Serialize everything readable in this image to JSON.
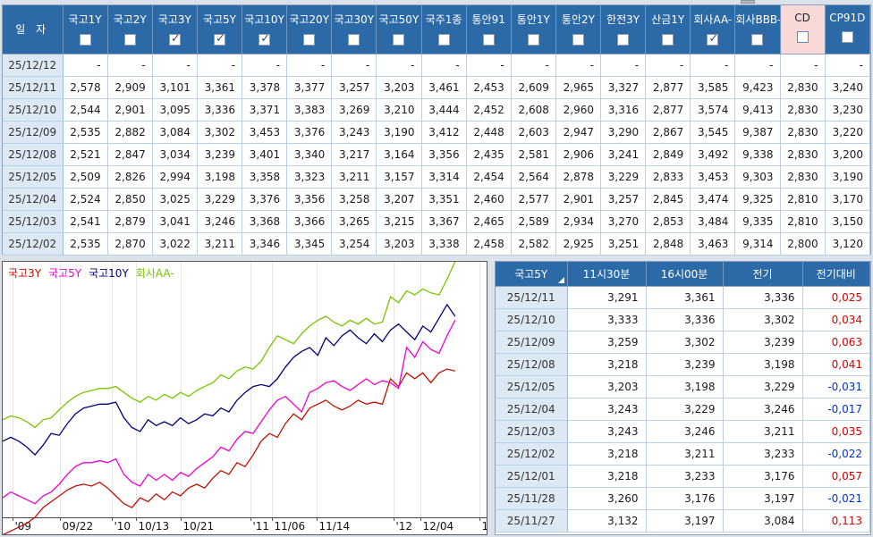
{
  "colors": {
    "header_blue": "#2b6aa6",
    "cd_pink": "#f9d8d8",
    "change_up": "#d40000",
    "change_down": "#0033cc"
  },
  "main_table": {
    "date_header": "일  자",
    "columns": [
      {
        "label": "국고1Y",
        "checked": false
      },
      {
        "label": "국고2Y",
        "checked": false
      },
      {
        "label": "국고3Y",
        "checked": true
      },
      {
        "label": "국고5Y",
        "checked": true
      },
      {
        "label": "국고10Y",
        "checked": true
      },
      {
        "label": "국고20Y",
        "checked": false
      },
      {
        "label": "국고30Y",
        "checked": false
      },
      {
        "label": "국고50Y",
        "checked": false
      },
      {
        "label": "국주1종",
        "checked": false
      },
      {
        "label": "통안91",
        "checked": false
      },
      {
        "label": "통안1Y",
        "checked": false
      },
      {
        "label": "통안2Y",
        "checked": false
      },
      {
        "label": "한전3Y",
        "checked": false
      },
      {
        "label": "산금1Y",
        "checked": false
      },
      {
        "label": "회사AA-",
        "checked": true
      },
      {
        "label": "회사BBB-",
        "checked": false
      },
      {
        "label": "CD",
        "checked": false,
        "highlight": true
      },
      {
        "label": "CP91D",
        "checked": false
      }
    ],
    "rows": [
      {
        "date": "25/12/12",
        "values": [
          "-",
          "-",
          "-",
          "-",
          "-",
          "-",
          "-",
          "-",
          "-",
          "-",
          "-",
          "-",
          "-",
          "-",
          "-",
          "-",
          "-",
          "-"
        ]
      },
      {
        "date": "25/12/11",
        "values": [
          "2,578",
          "2,909",
          "3,101",
          "3,361",
          "3,378",
          "3,377",
          "3,257",
          "3,203",
          "3,461",
          "2,453",
          "2,609",
          "2,965",
          "3,327",
          "2,877",
          "3,585",
          "9,423",
          "2,830",
          "3,240"
        ]
      },
      {
        "date": "25/12/10",
        "values": [
          "2,544",
          "2,901",
          "3,095",
          "3,336",
          "3,371",
          "3,383",
          "3,269",
          "3,210",
          "3,444",
          "2,452",
          "2,608",
          "2,960",
          "3,316",
          "2,877",
          "3,574",
          "9,413",
          "2,830",
          "3,230"
        ]
      },
      {
        "date": "25/12/09",
        "values": [
          "2,535",
          "2,882",
          "3,084",
          "3,302",
          "3,453",
          "3,376",
          "3,243",
          "3,190",
          "3,412",
          "2,448",
          "2,603",
          "2,947",
          "3,290",
          "2,867",
          "3,545",
          "9,387",
          "2,830",
          "3,220"
        ]
      },
      {
        "date": "25/12/08",
        "values": [
          "2,521",
          "2,847",
          "3,034",
          "3,239",
          "3,401",
          "3,340",
          "3,217",
          "3,164",
          "3,356",
          "2,435",
          "2,581",
          "2,906",
          "3,241",
          "2,849",
          "3,492",
          "9,338",
          "2,830",
          "3,200"
        ]
      },
      {
        "date": "25/12/05",
        "values": [
          "2,509",
          "2,826",
          "2,994",
          "3,198",
          "3,358",
          "3,323",
          "3,211",
          "3,157",
          "3,314",
          "2,454",
          "2,564",
          "2,878",
          "3,229",
          "2,833",
          "3,453",
          "9,303",
          "2,830",
          "3,190"
        ]
      },
      {
        "date": "25/12/04",
        "values": [
          "2,524",
          "2,850",
          "3,025",
          "3,229",
          "3,376",
          "3,356",
          "3,258",
          "3,207",
          "3,351",
          "2,460",
          "2,577",
          "2,901",
          "3,257",
          "2,845",
          "3,474",
          "9,325",
          "2,810",
          "3,170"
        ]
      },
      {
        "date": "25/12/03",
        "values": [
          "2,541",
          "2,879",
          "3,041",
          "3,246",
          "3,368",
          "3,366",
          "3,265",
          "3,215",
          "3,367",
          "2,465",
          "2,589",
          "2,934",
          "3,270",
          "2,853",
          "3,484",
          "9,335",
          "2,810",
          "3,150"
        ]
      },
      {
        "date": "25/12/02",
        "values": [
          "2,535",
          "2,870",
          "3,022",
          "3,211",
          "3,346",
          "3,345",
          "3,254",
          "3,203",
          "3,338",
          "2,458",
          "2,582",
          "2,925",
          "3,251",
          "2,848",
          "3,463",
          "9,314",
          "2,800",
          "3,120"
        ]
      }
    ]
  },
  "chart_data": {
    "type": "line",
    "title": "",
    "xlabel": "",
    "ylabel": "",
    "ylim": [
      2.35,
      3.65
    ],
    "grid": "vertical",
    "legend_position": "top-left",
    "x_tick_labels": [
      "'09",
      "09/22",
      "'10",
      "10/13",
      "10/21",
      "'11",
      "11/06",
      "11/14",
      "'12",
      "12/04",
      "1"
    ],
    "x_tick_positions": [
      0.02,
      0.118,
      0.225,
      0.275,
      0.367,
      0.512,
      0.556,
      0.648,
      0.808,
      0.863,
      0.985
    ],
    "x_data_end": 0.935,
    "series": [
      {
        "name": "국고3Y",
        "color": "#bb1100",
        "values": [
          2.26,
          2.28,
          2.3,
          2.32,
          2.35,
          2.4,
          2.43,
          2.46,
          2.49,
          2.51,
          2.52,
          2.51,
          2.53,
          2.5,
          2.46,
          2.42,
          2.4,
          2.45,
          2.43,
          2.47,
          2.44,
          2.48,
          2.46,
          2.5,
          2.52,
          2.5,
          2.55,
          2.59,
          2.57,
          2.63,
          2.61,
          2.67,
          2.74,
          2.78,
          2.76,
          2.83,
          2.88,
          2.85,
          2.91,
          2.93,
          2.95,
          2.92,
          2.9,
          2.92,
          2.95,
          2.93,
          2.94,
          2.93,
          3.06,
          3.02,
          3.09,
          3.06,
          3.09,
          3.04,
          3.09,
          3.11,
          3.1
        ]
      },
      {
        "name": "국고5Y",
        "color": "#ee00cc",
        "values": [
          2.45,
          2.48,
          2.46,
          2.44,
          2.42,
          2.46,
          2.48,
          2.52,
          2.57,
          2.61,
          2.63,
          2.63,
          2.64,
          2.63,
          2.65,
          2.57,
          2.53,
          2.51,
          2.57,
          2.54,
          2.57,
          2.54,
          2.58,
          2.56,
          2.6,
          2.63,
          2.66,
          2.71,
          2.69,
          2.75,
          2.79,
          2.78,
          2.84,
          2.9,
          2.95,
          2.97,
          2.93,
          2.89,
          2.99,
          3.01,
          3.04,
          3.05,
          3.02,
          3.0,
          3.03,
          3.06,
          3.03,
          3.05,
          3.04,
          3.01,
          3.22,
          3.17,
          3.25,
          3.21,
          3.19,
          3.28,
          3.36
        ]
      },
      {
        "name": "국고10Y",
        "color": "#000077",
        "values": [
          2.74,
          2.76,
          2.74,
          2.71,
          2.67,
          2.72,
          2.78,
          2.77,
          2.83,
          2.88,
          2.91,
          2.92,
          2.93,
          2.93,
          2.94,
          2.86,
          2.81,
          2.79,
          2.85,
          2.82,
          2.84,
          2.82,
          2.86,
          2.83,
          2.85,
          2.88,
          2.87,
          2.91,
          2.89,
          2.95,
          2.99,
          3.02,
          3.03,
          3.02,
          3.06,
          3.12,
          3.17,
          3.2,
          3.22,
          3.18,
          3.27,
          3.23,
          3.28,
          3.31,
          3.27,
          3.24,
          3.29,
          3.25,
          3.31,
          3.34,
          3.3,
          3.26,
          3.33,
          3.3,
          3.37,
          3.44,
          3.38
        ]
      },
      {
        "name": "회사AA-",
        "color": "#77c400",
        "values": [
          2.85,
          2.87,
          2.86,
          2.84,
          2.81,
          2.85,
          2.86,
          2.9,
          2.94,
          2.97,
          2.99,
          3.0,
          3.01,
          3.01,
          3.02,
          2.99,
          2.96,
          2.94,
          2.97,
          2.95,
          2.98,
          2.96,
          2.99,
          2.97,
          3.0,
          3.02,
          3.04,
          3.08,
          3.06,
          3.1,
          3.12,
          3.11,
          3.15,
          3.22,
          3.28,
          3.26,
          3.24,
          3.29,
          3.33,
          3.36,
          3.38,
          3.35,
          3.33,
          3.36,
          3.34,
          3.37,
          3.34,
          3.35,
          3.48,
          3.45,
          3.51,
          3.49,
          3.52,
          3.5,
          3.49,
          3.57,
          3.66
        ]
      }
    ]
  },
  "quote_table": {
    "headers": [
      "국고5Y",
      "11시30분",
      "16시00분",
      "전기",
      "전기대비"
    ],
    "rows": [
      {
        "date": "25/12/11",
        "t1130": "3,291",
        "t1600": "3,361",
        "prev": "3,336",
        "change": "0,025",
        "dir": "up"
      },
      {
        "date": "25/12/10",
        "t1130": "3,333",
        "t1600": "3,336",
        "prev": "3,302",
        "change": "0,034",
        "dir": "up"
      },
      {
        "date": "25/12/09",
        "t1130": "3,259",
        "t1600": "3,302",
        "prev": "3,239",
        "change": "0,063",
        "dir": "up"
      },
      {
        "date": "25/12/08",
        "t1130": "3,218",
        "t1600": "3,239",
        "prev": "3,198",
        "change": "0,041",
        "dir": "up"
      },
      {
        "date": "25/12/05",
        "t1130": "3,203",
        "t1600": "3,198",
        "prev": "3,229",
        "change": "-0,031",
        "dir": "down"
      },
      {
        "date": "25/12/04",
        "t1130": "3,243",
        "t1600": "3,229",
        "prev": "3,246",
        "change": "-0,017",
        "dir": "down"
      },
      {
        "date": "25/12/03",
        "t1130": "3,243",
        "t1600": "3,246",
        "prev": "3,211",
        "change": "0,035",
        "dir": "up"
      },
      {
        "date": "25/12/02",
        "t1130": "3,218",
        "t1600": "3,211",
        "prev": "3,233",
        "change": "-0,022",
        "dir": "down"
      },
      {
        "date": "25/12/01",
        "t1130": "3,218",
        "t1600": "3,233",
        "prev": "3,176",
        "change": "0,057",
        "dir": "up"
      },
      {
        "date": "25/11/28",
        "t1130": "3,260",
        "t1600": "3,176",
        "prev": "3,197",
        "change": "-0,021",
        "dir": "down"
      },
      {
        "date": "25/11/27",
        "t1130": "3,132",
        "t1600": "3,197",
        "prev": "3,084",
        "change": "0,113",
        "dir": "up"
      }
    ]
  }
}
